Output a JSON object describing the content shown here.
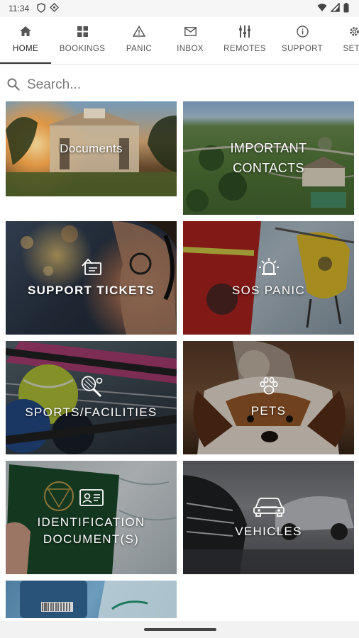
{
  "status_bar": {
    "time": "11:34"
  },
  "tabs": [
    {
      "label": "HOME",
      "icon": "home-icon",
      "active": true
    },
    {
      "label": "BOOKINGS",
      "icon": "grid-icon",
      "active": false
    },
    {
      "label": "PANIC",
      "icon": "warning-icon",
      "active": false
    },
    {
      "label": "INBOX",
      "icon": "mail-icon",
      "active": false
    },
    {
      "label": "REMOTES",
      "icon": "remote-icon",
      "active": false
    },
    {
      "label": "SUPPORT",
      "icon": "info-icon",
      "active": false
    },
    {
      "label": "SETT",
      "icon": "gear-icon",
      "active": false
    }
  ],
  "search": {
    "placeholder": "Search..."
  },
  "tiles": [
    {
      "label": "Documents",
      "icon": "none"
    },
    {
      "label": "IMPORTANT CONTACTS",
      "line1": "IMPORTANT",
      "line2": "CONTACTS",
      "icon": "none"
    },
    {
      "label": "SUPPORT TICKETS",
      "icon": "support-ticket-icon"
    },
    {
      "label": "SOS PANIC",
      "icon": "siren-icon"
    },
    {
      "label": "SPORTS/FACILITIES",
      "icon": "tennis-racket-icon"
    },
    {
      "label": "PETS",
      "icon": "paw-icon"
    },
    {
      "label": "IDENTIFICATION DOCUMENT(S)",
      "line1": "IDENTIFICATION",
      "line2": "DOCUMENT(S)",
      "icon": "id-card-icon"
    },
    {
      "label": "VEHICLES",
      "icon": "car-icon"
    },
    {
      "label": "",
      "icon": "medical-aid"
    }
  ],
  "colors": {
    "status_bar_bg": "#f6f6f6",
    "active_tab_underline": "#333333",
    "tile_text": "#ffffff"
  }
}
